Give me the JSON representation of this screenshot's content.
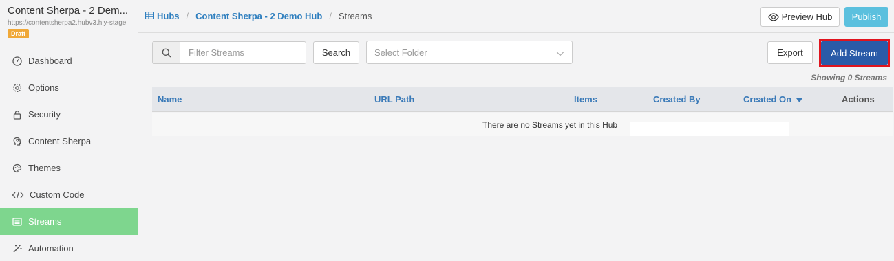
{
  "sidebar": {
    "hub_title": "Content Sherpa - 2 Dem...",
    "hub_url": "https://contentsherpa2.hubv3.hly-stage",
    "badge": "Draft",
    "items": [
      {
        "label": "Dashboard",
        "icon": "dashboard-icon"
      },
      {
        "label": "Options",
        "icon": "gear-icon"
      },
      {
        "label": "Security",
        "icon": "lock-icon"
      },
      {
        "label": "Content Sherpa",
        "icon": "brain-icon"
      },
      {
        "label": "Themes",
        "icon": "palette-icon"
      },
      {
        "label": "Custom Code",
        "icon": "code-icon"
      },
      {
        "label": "Streams",
        "icon": "list-icon",
        "active": true
      },
      {
        "label": "Automation",
        "icon": "magic-wand-icon"
      }
    ]
  },
  "breadcrumb": {
    "hubs": "Hubs",
    "hub": "Content Sherpa - 2 Demo Hub",
    "current": "Streams"
  },
  "header": {
    "preview_label": "Preview Hub",
    "publish_label": "Publish"
  },
  "toolbar": {
    "filter_placeholder": "Filter Streams",
    "search_label": "Search",
    "folder_placeholder": "Select Folder",
    "export_label": "Export",
    "add_label": "Add Stream",
    "showing": "Showing 0 Streams"
  },
  "table": {
    "columns": [
      "Name",
      "URL Path",
      "Items",
      "Created By",
      "Created On",
      "Actions"
    ],
    "empty_message": "There are no Streams yet in this Hub"
  },
  "colors": {
    "accent": "#2f7fbf",
    "active_nav": "#7ed68e",
    "primary_button": "#2a5ba8",
    "publish_button": "#5bc0de",
    "draft_badge": "#f0a838",
    "highlight_outline": "#e0141e"
  }
}
